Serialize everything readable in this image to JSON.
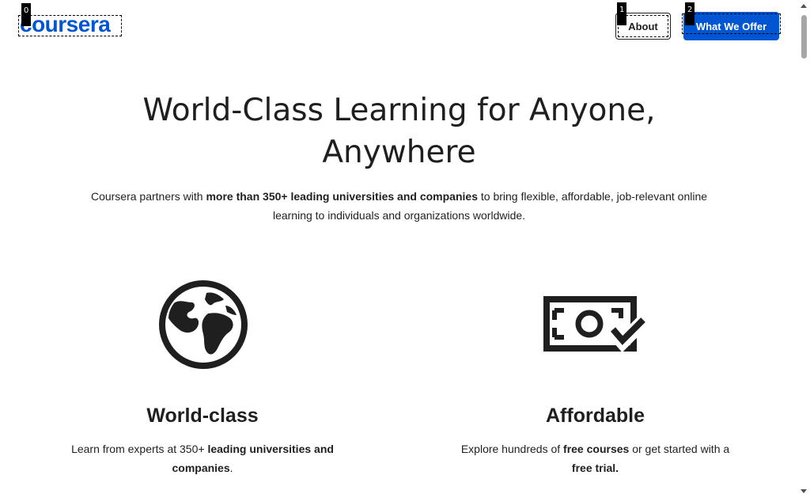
{
  "header": {
    "logo_text": "coursera",
    "tags": [
      "0",
      "1",
      "2"
    ],
    "about_label": "About",
    "offer_label": "What We Offer"
  },
  "hero": {
    "title_line1": "World-Class Learning for Anyone,",
    "title_line2": "Anywhere",
    "sub_pre": "Coursera partners with ",
    "sub_bold": "more than 350+ leading universities and companies",
    "sub_post": " to bring flexible, affordable, job-relevant online learning to individuals and organizations worldwide."
  },
  "features": [
    {
      "icon": "globe-icon",
      "title": "World-class",
      "text_pre": "Learn from experts at 350+ ",
      "text_bold": "leading universities and companies",
      "text_post": "."
    },
    {
      "icon": "money-check-icon",
      "title": "Affordable",
      "text_pre": "Explore hundreds of ",
      "text_bold": "free courses",
      "text_mid": " or get started with a ",
      "text_bold2": "free trial."
    }
  ],
  "colors": {
    "brand": "#0056d2",
    "text": "#1f1f1f"
  }
}
